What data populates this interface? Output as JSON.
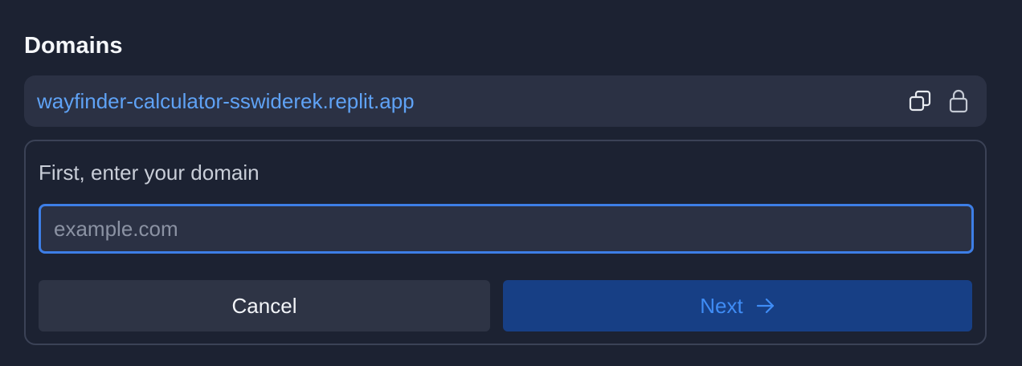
{
  "section": {
    "title": "Domains"
  },
  "domain_row": {
    "url": "wayfinder-calculator-sswiderek.replit.app",
    "copy_icon": "copy-icon",
    "lock_icon": "lock-icon"
  },
  "form": {
    "label": "First, enter your domain",
    "input_value": "",
    "input_placeholder": "example.com",
    "cancel_label": "Cancel",
    "next_label": "Next",
    "next_icon": "arrow-right-icon"
  },
  "colors": {
    "background": "#1c2232",
    "surface": "#2b3144",
    "link": "#5fa2f5",
    "focus_border": "#3d7ee6",
    "primary_button": "#173f85",
    "primary_text": "#3f8cf5"
  }
}
